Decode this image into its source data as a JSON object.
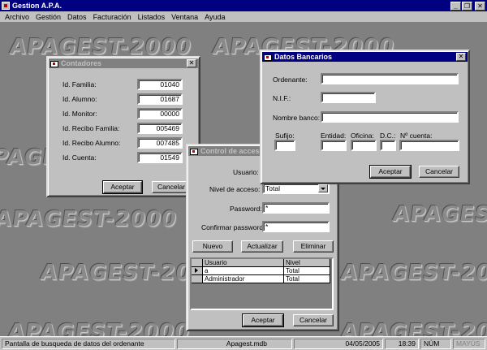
{
  "app": {
    "title": "Gestion A.P.A."
  },
  "menu": [
    "Archivo",
    "Gestión",
    "Datos",
    "Facturación",
    "Listados",
    "Ventana",
    "Ayuda"
  ],
  "watermark": "APAGEST-2000",
  "contadores": {
    "title": "Contadores",
    "fields": [
      {
        "label": "Id. Familia:",
        "value": "01040"
      },
      {
        "label": "Id. Alumno:",
        "value": "01687"
      },
      {
        "label": "Id. Monitor:",
        "value": "00000"
      },
      {
        "label": "Id. Recibo Familia:",
        "value": "005469"
      },
      {
        "label": "Id. Recibo Alumno:",
        "value": "007485"
      },
      {
        "label": "Id. Cuenta:",
        "value": "01549"
      }
    ],
    "accept": "Aceptar",
    "cancel": "Cancelar"
  },
  "banco": {
    "title": "Datos Bancarios",
    "ordenante_label": "Ordenante:",
    "nif_label": "N.I.F.:",
    "nombre_label": "Nombre banco:",
    "sufijo_label": "Sufijo:",
    "entidad_label": "Entidad:",
    "oficina_label": "Oficina:",
    "dc_label": "D.C.:",
    "cuenta_label": "Nº cuenta:",
    "ordenante": "",
    "nif": "",
    "nombre": "",
    "sufijo": "",
    "entidad": "",
    "oficina": "",
    "dc": "",
    "cuenta": "",
    "accept": "Aceptar",
    "cancel": "Cancelar"
  },
  "acceso": {
    "title": "Control de acceso",
    "usuario_label": "Usuario:",
    "nivel_label": "Nivel de acceso:",
    "nivel_value": "Total",
    "password_label": "Password:",
    "password_value": "*",
    "confirm_label": "Confirmar password:",
    "confirm_value": "*",
    "nuevo": "Nuevo",
    "actualizar": "Actualizar",
    "eliminar": "Eliminar",
    "columns": [
      "Usuario",
      "Nivel"
    ],
    "rows": [
      {
        "usuario": "a",
        "nivel": "Total"
      },
      {
        "usuario": "Administrador",
        "nivel": "Total"
      }
    ],
    "accept": "Aceptar",
    "cancel": "Cancelar"
  },
  "status": {
    "message": "Pantalla de busqueda de datos del ordenante",
    "file": "Apagest.mdb",
    "date": "04/05/2005",
    "time": "18:39",
    "num": "NÚM",
    "caps": "MAYÚS"
  }
}
